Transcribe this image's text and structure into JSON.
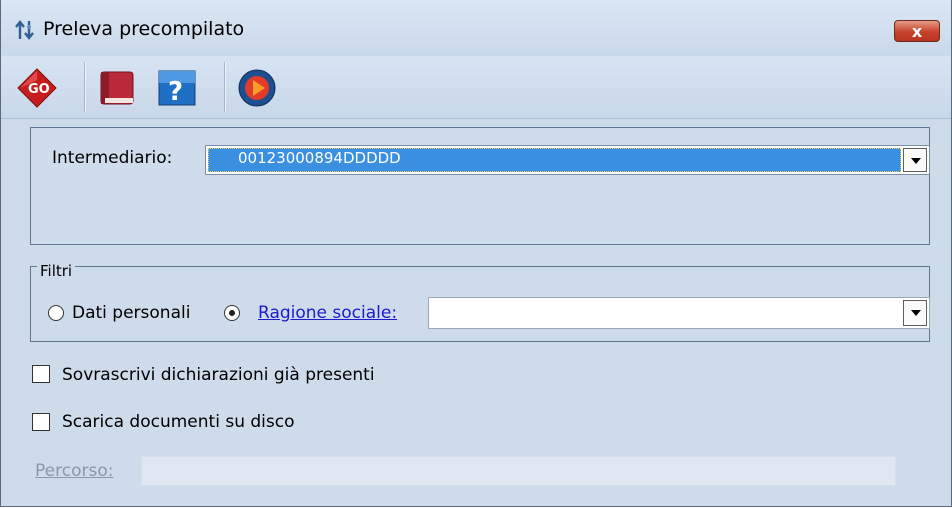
{
  "window": {
    "title": "Preleva precompilato",
    "close_label": "x"
  },
  "toolbar": {
    "buttons": [
      {
        "icon": "go-icon",
        "label": "GO"
      },
      {
        "icon": "book-icon"
      },
      {
        "icon": "help-icon",
        "label": "?"
      },
      {
        "icon": "exit-icon"
      }
    ]
  },
  "intermediario": {
    "label": "Intermediario:",
    "value": "00123000894DDDDD"
  },
  "filtri": {
    "legend": "Filtri",
    "option_dati_personali": "Dati personali",
    "option_ragione_sociale": "Ragione sociale:",
    "selected": "ragione_sociale",
    "ragione_sociale_value": ""
  },
  "options": {
    "sovrascrivi_label": "Sovrascrivi dichiarazioni già presenti",
    "sovrascrivi_checked": false,
    "scarica_label": "Scarica documenti su disco",
    "scarica_checked": false
  },
  "percorso": {
    "label": "Percorso:",
    "value": ""
  },
  "colors": {
    "selection": "#3b8fe0",
    "link": "#1b1bcc",
    "window_bg": "#cddbeb"
  }
}
